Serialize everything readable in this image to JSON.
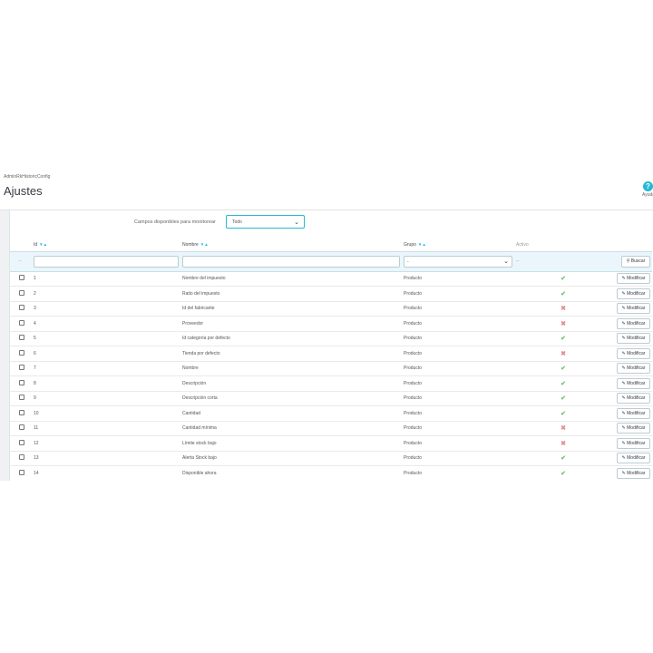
{
  "header": {
    "breadcrumb": "AdminRkHistoricConfig",
    "title": "Ajustes",
    "help_label": "Ayuda",
    "help_symbol": "?"
  },
  "monitor": {
    "label": "Campos disponibles para monitorear",
    "selected": "Todo"
  },
  "table": {
    "columns": {
      "id": "Id",
      "nombre": "Nombre",
      "grupo": "Grupo",
      "activo": "Activo"
    },
    "sort_arrows": "▼▲",
    "filter": {
      "checkbox_dash": "--",
      "grupo_selected": "-",
      "activo_dash": "--",
      "search_label": "Buscar"
    },
    "edit_label": "Modificar",
    "rows": [
      {
        "id": "1",
        "nombre": "Nombre del impuesto",
        "grupo": "Producto",
        "activo": true
      },
      {
        "id": "2",
        "nombre": "Ratio del impuesto",
        "grupo": "Producto",
        "activo": true
      },
      {
        "id": "3",
        "nombre": "Id del fabricante",
        "grupo": "Producto",
        "activo": false
      },
      {
        "id": "4",
        "nombre": "Proveedor",
        "grupo": "Producto",
        "activo": false
      },
      {
        "id": "5",
        "nombre": "Id categoría por defecto",
        "grupo": "Producto",
        "activo": true
      },
      {
        "id": "6",
        "nombre": "Tienda por defecto",
        "grupo": "Producto",
        "activo": false
      },
      {
        "id": "7",
        "nombre": "Nombre",
        "grupo": "Producto",
        "activo": true
      },
      {
        "id": "8",
        "nombre": "Descripción",
        "grupo": "Producto",
        "activo": true
      },
      {
        "id": "9",
        "nombre": "Descripción corta",
        "grupo": "Producto",
        "activo": true
      },
      {
        "id": "10",
        "nombre": "Cantidad",
        "grupo": "Producto",
        "activo": true
      },
      {
        "id": "11",
        "nombre": "Cantidad mínima",
        "grupo": "Producto",
        "activo": false
      },
      {
        "id": "12",
        "nombre": "Límite stock bajo",
        "grupo": "Producto",
        "activo": false
      },
      {
        "id": "13",
        "nombre": "Alerta Stock bajo",
        "grupo": "Producto",
        "activo": true
      },
      {
        "id": "14",
        "nombre": "Disponible ahora",
        "grupo": "Producto",
        "activo": true
      }
    ]
  },
  "colors": {
    "accent": "#25b9d7",
    "active": "#72c279",
    "inactive": "#e08f95"
  }
}
